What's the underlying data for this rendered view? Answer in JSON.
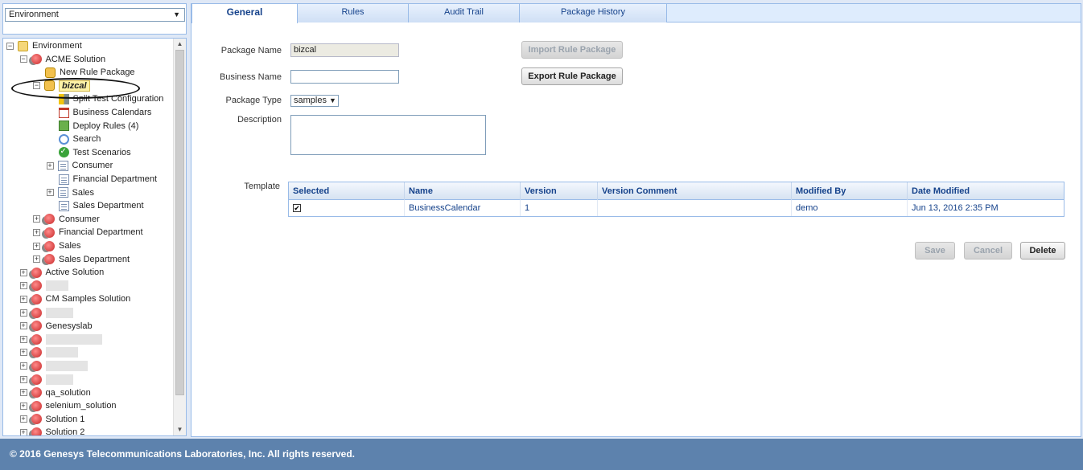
{
  "environment_select": {
    "value": "Environment"
  },
  "tree": [
    {
      "label": "Environment",
      "toggle": "−",
      "icon": "folder",
      "level": 0
    },
    {
      "label": "ACME Solution",
      "toggle": "−",
      "icon": "solution",
      "level": 1
    },
    {
      "label": "New Rule Package",
      "toggle": "",
      "icon": "package",
      "level": 2
    },
    {
      "label": "bizcal",
      "toggle": "−",
      "icon": "package",
      "level": 2,
      "selected": true
    },
    {
      "label": "Split Test Configuration",
      "toggle": "",
      "icon": "split",
      "level": 3
    },
    {
      "label": "Business Calendars",
      "toggle": "",
      "icon": "calendar",
      "level": 3
    },
    {
      "label": "Deploy Rules (4)",
      "toggle": "",
      "icon": "deploy",
      "level": 3
    },
    {
      "label": "Search",
      "toggle": "",
      "icon": "search",
      "level": 3
    },
    {
      "label": "Test Scenarios",
      "toggle": "",
      "icon": "check",
      "level": 3
    },
    {
      "label": "Consumer",
      "toggle": "+",
      "icon": "doc",
      "level": 3
    },
    {
      "label": "Financial Department",
      "toggle": "",
      "icon": "doc",
      "level": 3
    },
    {
      "label": "Sales",
      "toggle": "+",
      "icon": "doc",
      "level": 3
    },
    {
      "label": "Sales Department",
      "toggle": "",
      "icon": "doc",
      "level": 3
    },
    {
      "label": "Consumer",
      "toggle": "+",
      "icon": "solution",
      "level": 2
    },
    {
      "label": "Financial Department",
      "toggle": "+",
      "icon": "solution",
      "level": 2
    },
    {
      "label": "Sales",
      "toggle": "+",
      "icon": "solution",
      "level": 2
    },
    {
      "label": "Sales Department",
      "toggle": "+",
      "icon": "solution",
      "level": 2
    },
    {
      "label": "Active Solution",
      "toggle": "+",
      "icon": "solution",
      "level": 1
    },
    {
      "label": "",
      "toggle": "+",
      "icon": "solution",
      "level": 1,
      "redacted": 28
    },
    {
      "label": "CM Samples Solution",
      "toggle": "+",
      "icon": "solution",
      "level": 1
    },
    {
      "label": "",
      "toggle": "+",
      "icon": "solution",
      "level": 1,
      "redacted": 34
    },
    {
      "label": "Genesyslab",
      "toggle": "+",
      "icon": "solution",
      "level": 1
    },
    {
      "label": "",
      "toggle": "+",
      "icon": "solution",
      "level": 1,
      "redacted": 70
    },
    {
      "label": "",
      "toggle": "+",
      "icon": "solution",
      "level": 1,
      "redacted": 40
    },
    {
      "label": "",
      "toggle": "+",
      "icon": "solution",
      "level": 1,
      "redacted": 52
    },
    {
      "label": "",
      "toggle": "+",
      "icon": "solution",
      "level": 1,
      "redacted": 34
    },
    {
      "label": "qa_solution",
      "toggle": "+",
      "icon": "solution",
      "level": 1
    },
    {
      "label": "selenium_solution",
      "toggle": "+",
      "icon": "solution",
      "level": 1
    },
    {
      "label": "Solution 1",
      "toggle": "+",
      "icon": "solution",
      "level": 1
    },
    {
      "label": "Solution 2",
      "toggle": "+",
      "icon": "solution",
      "level": 1
    }
  ],
  "tabs": [
    {
      "label": "General",
      "active": true
    },
    {
      "label": "Rules",
      "active": false
    },
    {
      "label": "Audit Trail",
      "active": false
    },
    {
      "label": "Package History",
      "active": false
    }
  ],
  "form": {
    "package_name_label": "Package Name",
    "package_name_value": "bizcal",
    "business_name_label": "Business Name",
    "business_name_value": "",
    "package_type_label": "Package Type",
    "package_type_value": "samples",
    "description_label": "Description",
    "description_value": "",
    "template_label": "Template"
  },
  "buttons": {
    "import": "Import Rule Package",
    "export": "Export Rule Package",
    "save": "Save",
    "cancel": "Cancel",
    "delete": "Delete"
  },
  "template_grid": {
    "columns": [
      "Selected",
      "Name",
      "Version",
      "Version Comment",
      "Modified By",
      "Date Modified"
    ],
    "rows": [
      {
        "selected": "✔",
        "name": "BusinessCalendar",
        "version": "1",
        "comment": "",
        "modified_by": "demo",
        "date_modified": "Jun 13, 2016 2:35 PM"
      }
    ]
  },
  "footer": {
    "text": "© 2016 Genesys Telecommunications Laboratories, Inc. All rights reserved."
  },
  "colors": {
    "panel_border": "#99bbe8",
    "header_text": "#15428b",
    "footer_bg": "#5d82ad"
  }
}
